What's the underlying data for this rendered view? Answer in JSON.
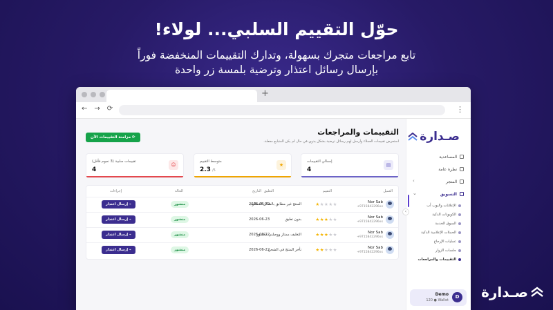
{
  "promo": {
    "headline": "حوّل التقييم السلبي... لولاء!",
    "line1": "تابع مراجعات متجرك بسهولة، وتدارك التقييمات المنخفضة فوراً",
    "line2": "بإرسال رسائل اعتذار وترضية بلمسة زر واحدة",
    "brand": "صـدارة"
  },
  "browser": {
    "new_tab": "+",
    "kebab": "⋮",
    "back": "←",
    "forward": "→",
    "reload": "⟳"
  },
  "sidebar": {
    "logo": "صـدارة",
    "items": [
      {
        "label": "المساعدية",
        "icon": "home-icon"
      },
      {
        "label": "نظرة عامة",
        "icon": "grid-icon"
      },
      {
        "label": "المتجر",
        "icon": "store-icon",
        "chevron": "›"
      },
      {
        "label": "التسويق",
        "icon": "megaphone-icon",
        "chevron": "⌄"
      }
    ],
    "subitems": [
      "الإعلانات والبوب أب",
      "الكوبونات الذكية",
      "السوق الخدمة",
      "الحملات الإعلامية الذكية",
      "عمليات الإرجاع",
      "جلسات الزوار",
      "التقييمات والمراجعات"
    ],
    "collapse": "›",
    "user": {
      "initial": "D",
      "name": "Demo",
      "balance": "120 ● Wallet"
    }
  },
  "main": {
    "title": "التقييمات والمراجعات",
    "subtitle": "استعرض تقييمات العملاء وأرسل لهم رسائل ترضية بشكل يدوي في حال لم يكن المتبايع مفعلة.",
    "sync_button": "⟳ مزامنة التقييمات الآن",
    "cards": [
      {
        "label": "إجمالي التقييمات",
        "value": "4",
        "unit": "",
        "icon": "chat-icon",
        "color": "#6c63c7",
        "bg": "#ecebfa"
      },
      {
        "label": "متوسط التقييم",
        "value": "2.3",
        "unit": "/5",
        "icon": "star-icon",
        "color": "#f0a500",
        "bg": "#fdf3dc"
      },
      {
        "label": "تقييمات سلبية (3 نجوم فأقل)",
        "value": "4",
        "unit": "",
        "icon": "frown-icon",
        "color": "#e5484d",
        "bg": "#fde8e8"
      }
    ],
    "headers": {
      "customer": "العميل",
      "rating": "التقييم",
      "comment": "التعليق",
      "date": "التاريخ",
      "status": "الحالة",
      "actions": "إجراءات"
    },
    "rows": [
      {
        "name": "Nor Sab",
        "phone": "+9715842296xx",
        "rating": 1,
        "comment": "المنتج غير مطابق بالشكل المطلوب",
        "date": "2026-06-29",
        "status": "منشور",
        "action": "⌁ إرسال اعتذار"
      },
      {
        "name": "Nor Sab",
        "phone": "+9715842296xx",
        "rating": 3,
        "comment": "بدون تعليق",
        "date": "2026-06-23",
        "status": "منشور",
        "action": "⌁ إرسال اعتذار"
      },
      {
        "name": "Nor Sab",
        "phone": "+9715842296xx",
        "rating": 3,
        "comment": "التغليف ممتاز ووصلني مكسور",
        "date": "2026-06-22",
        "status": "منشور",
        "action": "⌁ إرسال اعتذار"
      },
      {
        "name": "Nor Sab",
        "phone": "+9715842296xx",
        "rating": 2,
        "comment": "تأخر المنتج في الشحن",
        "date": "2026-06-22",
        "status": "منشور",
        "action": "⌁ إرسال اعتذار"
      }
    ]
  }
}
